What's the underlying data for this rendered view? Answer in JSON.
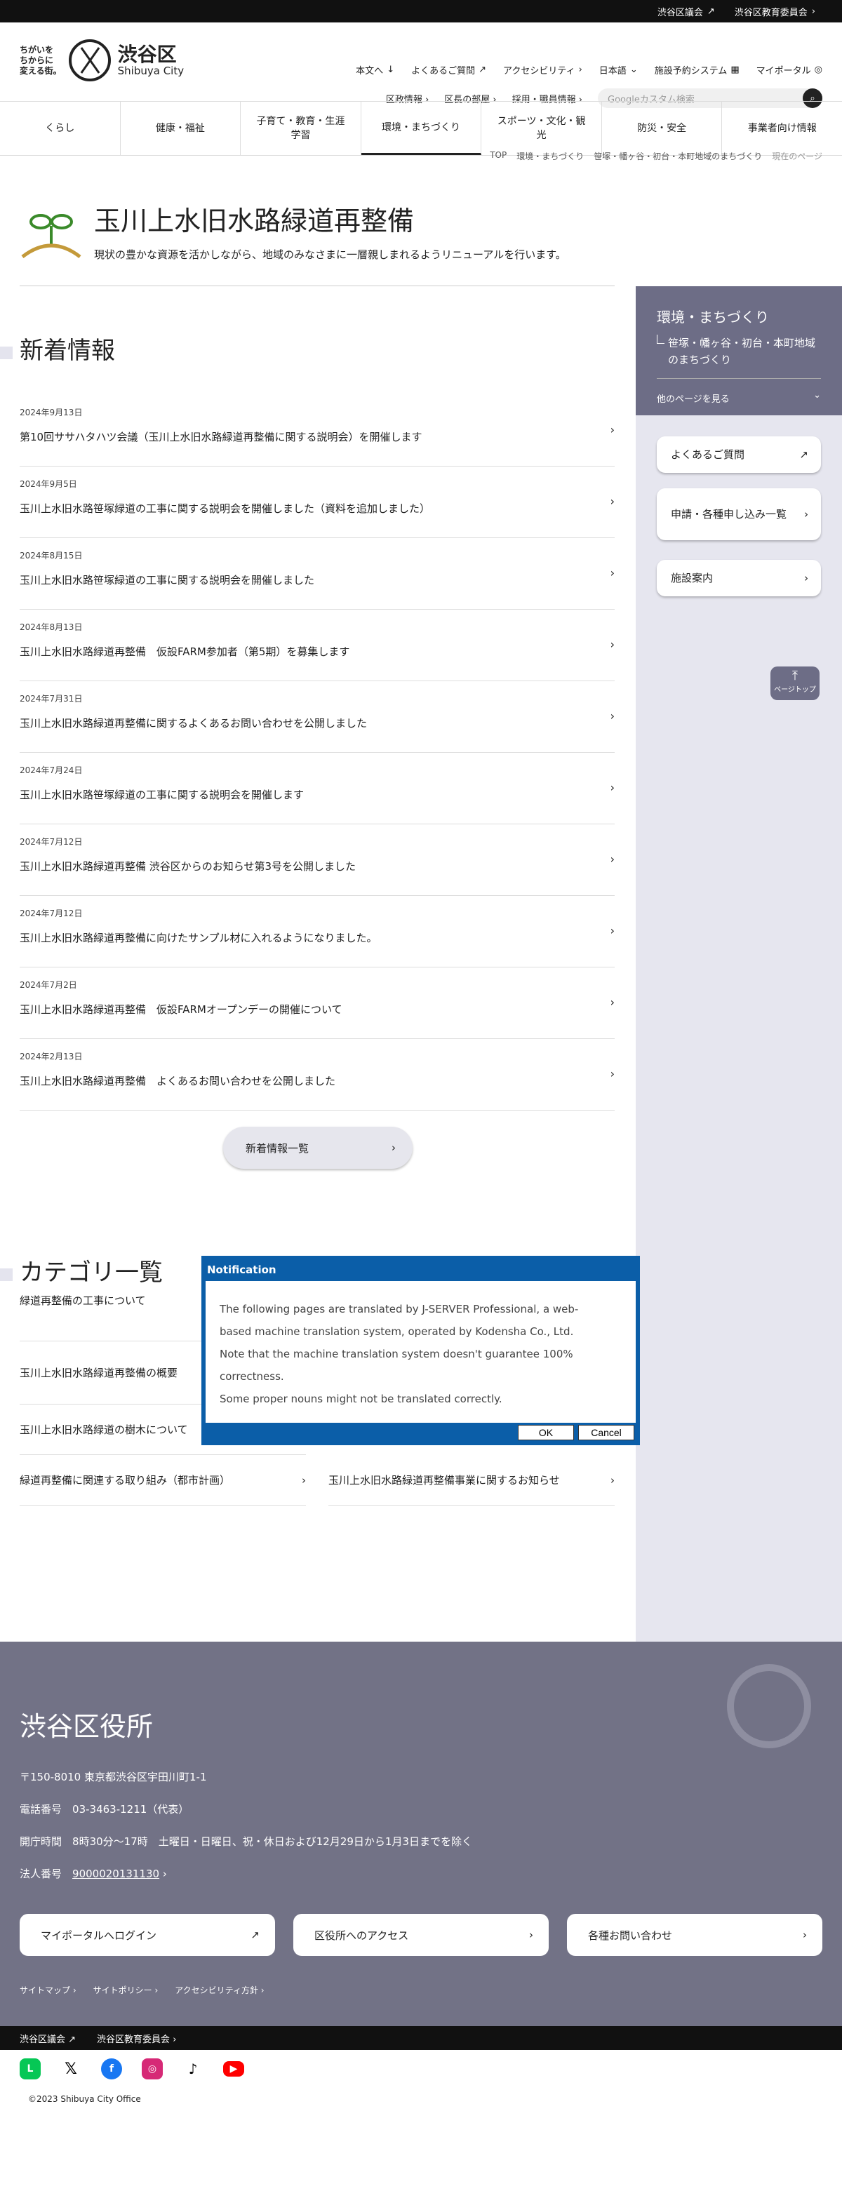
{
  "topbar": {
    "links": [
      "渋谷区議会",
      "渋谷区教育委員会"
    ]
  },
  "logo": {
    "tagline": [
      "ちがいを",
      "ちからに",
      "変える街。"
    ],
    "name": "渋谷区",
    "name_en": "Shibuya City"
  },
  "header": {
    "nav1": [
      "本文へ",
      "よくあるご質問",
      "アクセシビリティ",
      "日本語",
      "施設予約システム",
      "マイポータル"
    ],
    "nav2": [
      "区政情報",
      "区長の部屋",
      "採用・職員情報"
    ],
    "search_placeholder": "Googleカスタム検索"
  },
  "gnav": [
    "くらし",
    "健康・福祉",
    "子育て・教育・生涯学習",
    "環境・まちづくり",
    "スポーツ・文化・観光",
    "防災・安全",
    "事業者向け情報"
  ],
  "breadcrumb": [
    "TOP",
    "環境・まちづくり",
    "笹塚・幡ヶ谷・初台・本町地域のまちづくり",
    "現在のページ"
  ],
  "page": {
    "title": "玉川上水旧水路緑道再整備",
    "lead": "現状の豊かな資源を活かしながら、地域のみなさまに一層親しまれるようリニューアルを行います。"
  },
  "news": {
    "heading": "新着情報",
    "items": [
      {
        "date": "2024年9月13日",
        "title": "第10回ササハタハツ会議（玉川上水旧水路緑道再整備に関する説明会）を開催します"
      },
      {
        "date": "2024年9月5日",
        "title": "玉川上水旧水路笹塚緑道の工事に関する説明会を開催しました（資料を追加しました）"
      },
      {
        "date": "2024年8月15日",
        "title": "玉川上水旧水路笹塚緑道の工事に関する説明会を開催しました"
      },
      {
        "date": "2024年8月13日",
        "title": "玉川上水旧水路緑道再整備　仮設FARM参加者（第5期）を募集します"
      },
      {
        "date": "2024年7月31日",
        "title": "玉川上水旧水路緑道再整備に関するよくあるお問い合わせを公開しました"
      },
      {
        "date": "2024年7月24日",
        "title": "玉川上水旧水路笹塚緑道の工事に関する説明会を開催します"
      },
      {
        "date": "2024年7月12日",
        "title": "玉川上水旧水路緑道再整備 渋谷区からのお知らせ第3号を公開しました"
      },
      {
        "date": "2024年7月12日",
        "title": "玉川上水旧水路緑道再整備に向けたサンプル材に入れるようになりました。"
      },
      {
        "date": "2024年7月2日",
        "title": "玉川上水旧水路緑道再整備　仮設FARMオープンデーの開催について"
      },
      {
        "date": "2024年2月13日",
        "title": "玉川上水旧水路緑道再整備　よくあるお問い合わせを公開しました"
      }
    ],
    "more_label": "新着情報一覧"
  },
  "categories": {
    "heading": "カテゴリ一覧",
    "items": [
      "緑道再整備の工事について",
      "玉川上水旧水路緑道再整備の概要",
      "玉川上水旧水路緑道の樹木について",
      "緑道再整備に関連する取り組み（都市計画）",
      "玉川上水旧水路緑道再整備事業に関するお知らせ"
    ]
  },
  "sidebar": {
    "title": "環境・まちづくり",
    "sub": "笹塚・幡ヶ谷・初台・本町地域のまちづくり",
    "more": "他のページを見る",
    "buttons": [
      "よくあるご質問",
      "申請・各種申し込み一覧",
      "施設案内"
    ],
    "pagetop": "ページトップ"
  },
  "footer": {
    "title": "渋谷区役所",
    "address": "〒150-8010 東京都渋谷区宇田川町1-1",
    "phone_label": "電話番号",
    "phone": "03-3463-1211（代表）",
    "hours_label": "開庁時間",
    "hours": "8時30分～17時　土曜日・日曜日、祝・休日および12月29日から1月3日までを除く",
    "corp_label": "法人番号",
    "corp": "9000020131130",
    "buttons": [
      "マイポータルへログイン",
      "区役所へのアクセス",
      "各種お問い合わせ"
    ],
    "links": [
      "サイトマップ",
      "サイトポリシー",
      "アクセシビリティ方針"
    ],
    "bottom_links": [
      "渋谷区議会",
      "渋谷区教育委員会"
    ],
    "copyright": "©2023 Shibuya City Office"
  },
  "dialog": {
    "title": "Notification",
    "lines": [
      "The following pages are translated by J-SERVER Professional, a web-",
      "based machine translation system, operated by Kodensha Co., Ltd.",
      "Note that the machine translation system doesn't guarantee 100%",
      "correctness.",
      "Some proper nouns might not be translated correctly."
    ],
    "ok": "OK",
    "cancel": "Cancel"
  },
  "colors": {
    "sidebar_head": "#6d6d86",
    "footer": "#727286",
    "dialog": "#0b5ea8"
  }
}
